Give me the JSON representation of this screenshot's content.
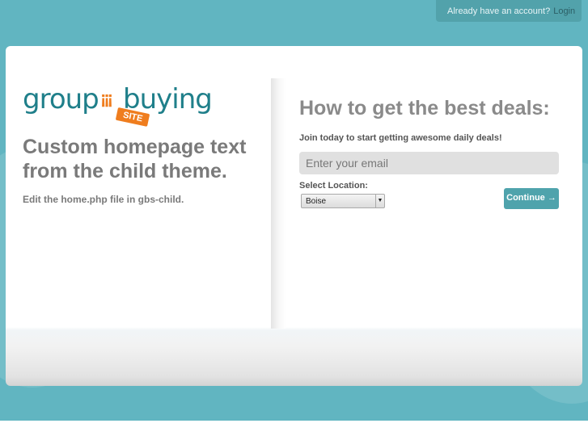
{
  "topbar": {
    "prompt": "Already have an account?",
    "login": "Login"
  },
  "logo": {
    "left": "group",
    "right": "buying",
    "tag": "SITE"
  },
  "left": {
    "heading": "Custom homepage text from the child theme.",
    "subtext": "Edit the home.php file in gbs-child."
  },
  "right": {
    "heading": "How to get the best deals:",
    "join": "Join today to start getting awesome daily deals!",
    "email_placeholder": "Enter your email",
    "location_label": "Select Location:",
    "location_value": "Boise",
    "continue": "Continue →"
  }
}
